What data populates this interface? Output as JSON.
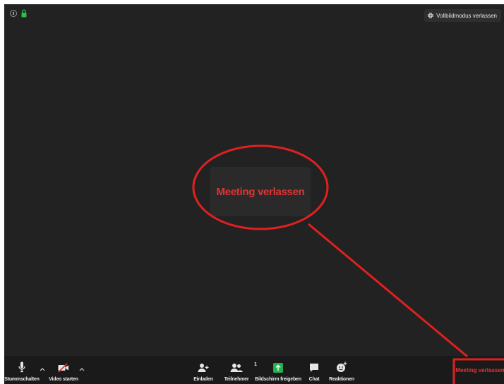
{
  "topbar": {
    "fullscreen_exit_label": "Vollbildmodus verlassen"
  },
  "popup": {
    "label": "Meeting verlassen"
  },
  "toolbar": {
    "mute_label": "Stummschalten",
    "video_label": "Video starten",
    "invite_label": "Einladen",
    "participants_label": "Teilnehmer",
    "participants_count": "1",
    "share_label": "Bildschirm freigeben",
    "chat_label": "Chat",
    "reactions_label": "Reaktionen",
    "leave_label": "Meeting verlassen"
  },
  "colors": {
    "background": "#222222",
    "toolbar": "#1a1a1a",
    "annotation_red": "#e02020",
    "share_green": "#23b14d",
    "leave_text": "#e23434"
  }
}
